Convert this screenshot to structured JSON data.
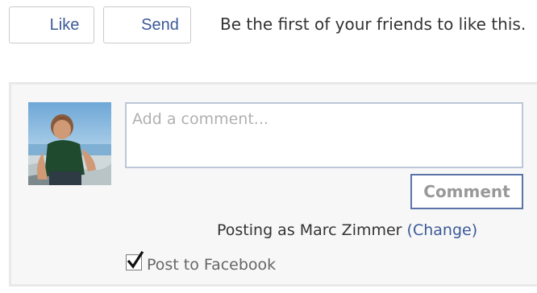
{
  "actions": {
    "like_label": "Like",
    "send_label": "Send"
  },
  "social": {
    "friends_text": "Be the first of your friends to like this."
  },
  "comment": {
    "placeholder": "Add a comment...",
    "submit_label": "Comment",
    "posting_as_prefix": "Posting as Marc Zimmer",
    "change_label": "(Change)",
    "post_to_label": "Post to Facebook",
    "post_to_checked": true
  },
  "icons": {
    "avatar": "user-avatar-photo",
    "checkbox": "checkmark-icon"
  },
  "colors": {
    "link": "#3b5998",
    "border": "#bdc7d8",
    "panel_bg": "#f7f7f7"
  }
}
